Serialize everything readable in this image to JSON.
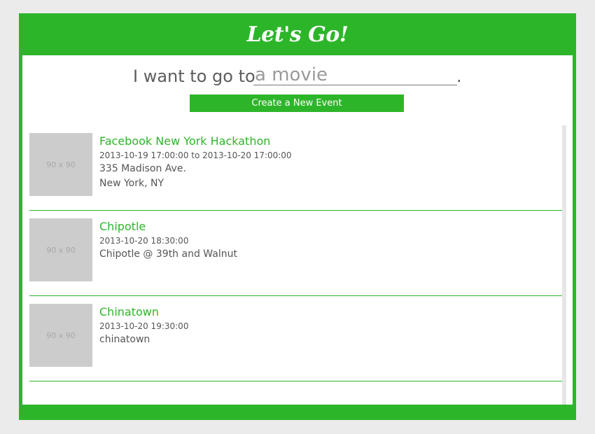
{
  "app": {
    "title": "Let's Go!"
  },
  "prompt": {
    "label": "I want to go to",
    "placeholder": "a movie",
    "suffix": ".",
    "create_button": "Create a New Event"
  },
  "events": [
    {
      "thumbnail": "90 x 90",
      "name": "Facebook New York Hackathon",
      "time": "2013-10-19 17:00:00 to 2013-10-20 17:00:00",
      "line1": "335 Madison Ave.",
      "line2": "New York, NY"
    },
    {
      "thumbnail": "90 x 90",
      "name": "Chipotle",
      "time": "2013-10-20 18:30:00",
      "line1": "Chipotle @ 39th and Walnut",
      "line2": ""
    },
    {
      "thumbnail": "90 x 90",
      "name": "Chinatown",
      "time": "2013-10-20 19:30:00",
      "line1": "chinatown",
      "line2": ""
    }
  ],
  "colors": {
    "accent": "#2db52a",
    "background": "#ebebeb",
    "text": "#555555",
    "placeholder_box": "#cccccc"
  }
}
